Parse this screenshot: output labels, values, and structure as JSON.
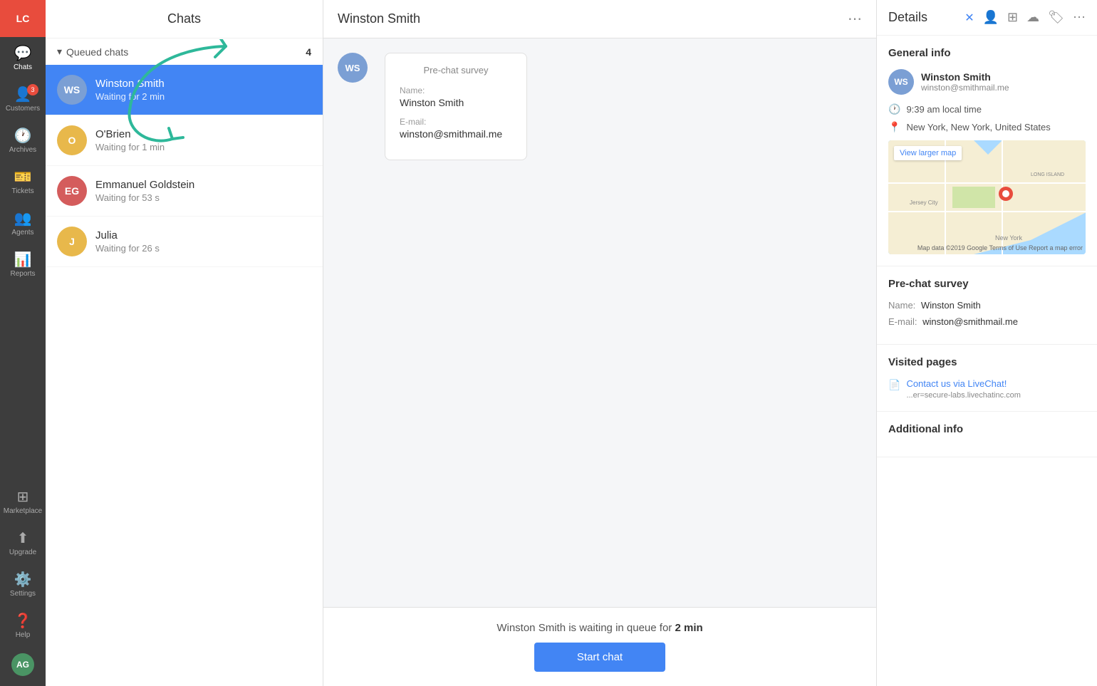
{
  "app": {
    "logo": "LC"
  },
  "sidebar": {
    "items": [
      {
        "id": "chats",
        "label": "Chats",
        "icon": "💬",
        "badge": null,
        "active": true
      },
      {
        "id": "customers",
        "label": "Customers",
        "icon": "👤",
        "badge": "3"
      },
      {
        "id": "archives",
        "label": "Archives",
        "icon": "🕐",
        "badge": null
      },
      {
        "id": "tickets",
        "label": "Tickets",
        "icon": "🎫",
        "badge": null
      },
      {
        "id": "agents",
        "label": "Agents",
        "icon": "👥",
        "badge": null
      },
      {
        "id": "reports",
        "label": "Reports",
        "icon": "📊",
        "badge": null
      }
    ],
    "bottom_items": [
      {
        "id": "marketplace",
        "label": "Marketplace",
        "icon": "⊞"
      },
      {
        "id": "upgrade",
        "label": "Upgrade",
        "icon": "↑"
      },
      {
        "id": "settings",
        "label": "Settings",
        "icon": "⚙️"
      },
      {
        "id": "help",
        "label": "Help",
        "icon": "❓"
      }
    ]
  },
  "chats_panel": {
    "title": "Chats",
    "queued_section": {
      "label": "Queued chats",
      "count": 4
    },
    "queue_items": [
      {
        "id": "1",
        "initials": "WS",
        "name": "Winston Smith",
        "status": "Waiting for 2 min",
        "color": "#7b9fd4",
        "active": true
      },
      {
        "id": "2",
        "initials": "O",
        "name": "O'Brien",
        "status": "Waiting for 1 min",
        "color": "#e8b84b",
        "active": false
      },
      {
        "id": "3",
        "initials": "EG",
        "name": "Emmanuel Goldstein",
        "status": "Waiting for 53 s",
        "color": "#d45c5c",
        "active": false
      },
      {
        "id": "4",
        "initials": "J",
        "name": "Julia",
        "status": "Waiting for 26 s",
        "color": "#e8b84b",
        "active": false
      }
    ]
  },
  "main_chat": {
    "header_title": "Winston Smith",
    "pre_chat_survey_label": "Pre-chat survey",
    "name_label": "Name:",
    "name_value": "Winston Smith",
    "email_label": "E-mail:",
    "email_value": "winston@smithmail.me",
    "waiting_text": "Winston Smith is waiting in queue for",
    "waiting_duration": "2 min",
    "start_chat_label": "Start chat"
  },
  "details_panel": {
    "title": "Details",
    "more_icon": "⋯",
    "close_icon": "✕",
    "sections": {
      "general_info": {
        "title": "General info",
        "avatar_initials": "WS",
        "avatar_color": "#7b9fd4",
        "name": "Winston Smith",
        "email": "winston@smithmail.me",
        "local_time": "9:39 am local time",
        "location": "New York, New York, United States",
        "map_label": "View larger map",
        "map_caption": "Map data ©2019 Google  Terms of Use  Report a map error"
      },
      "pre_chat_survey": {
        "title": "Pre-chat survey",
        "name_label": "Name:",
        "name_value": "Winston Smith",
        "email_label": "E-mail:",
        "email_value": "winston@smithmail.me"
      },
      "visited_pages": {
        "title": "Visited pages",
        "pages": [
          {
            "link_text": "Contact us via LiveChat!",
            "url": "...er=secure-labs.livechatinc.com"
          }
        ]
      },
      "additional_info": {
        "title": "Additional info"
      }
    }
  }
}
